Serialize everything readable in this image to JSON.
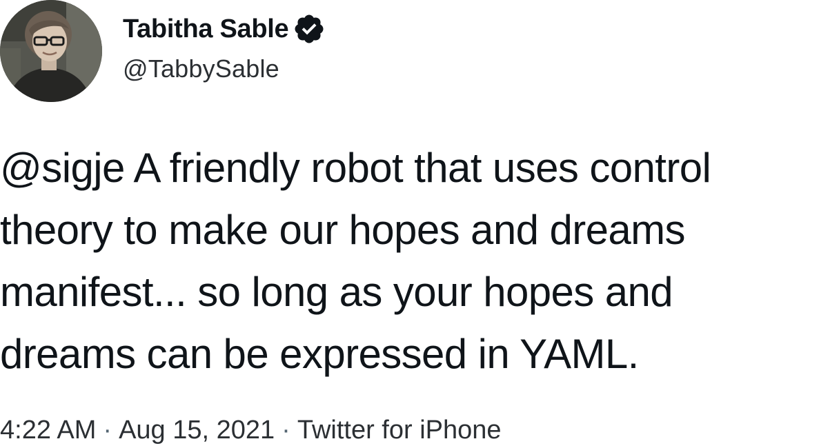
{
  "author": {
    "display_name": "Tabitha Sable",
    "handle": "@TabbySable",
    "verified": true,
    "avatar_icon": "profile-photo",
    "verified_icon": "verified-badge-icon"
  },
  "tweet": {
    "lines": [
      {
        "mention": "@sigje",
        "text": " A friendly robot that uses control"
      },
      {
        "text": "theory to make our hopes and dreams"
      },
      {
        "text": "manifest... so long as your hopes and"
      },
      {
        "text": "dreams can be expressed in YAML."
      }
    ]
  },
  "meta": {
    "time": "4:22 AM",
    "separator": "·",
    "date": "Aug 15, 2021",
    "source": "Twitter for iPhone"
  },
  "colors": {
    "text": "#0f1419",
    "secondary": "#2b2f33",
    "badge": "#0f1419"
  }
}
